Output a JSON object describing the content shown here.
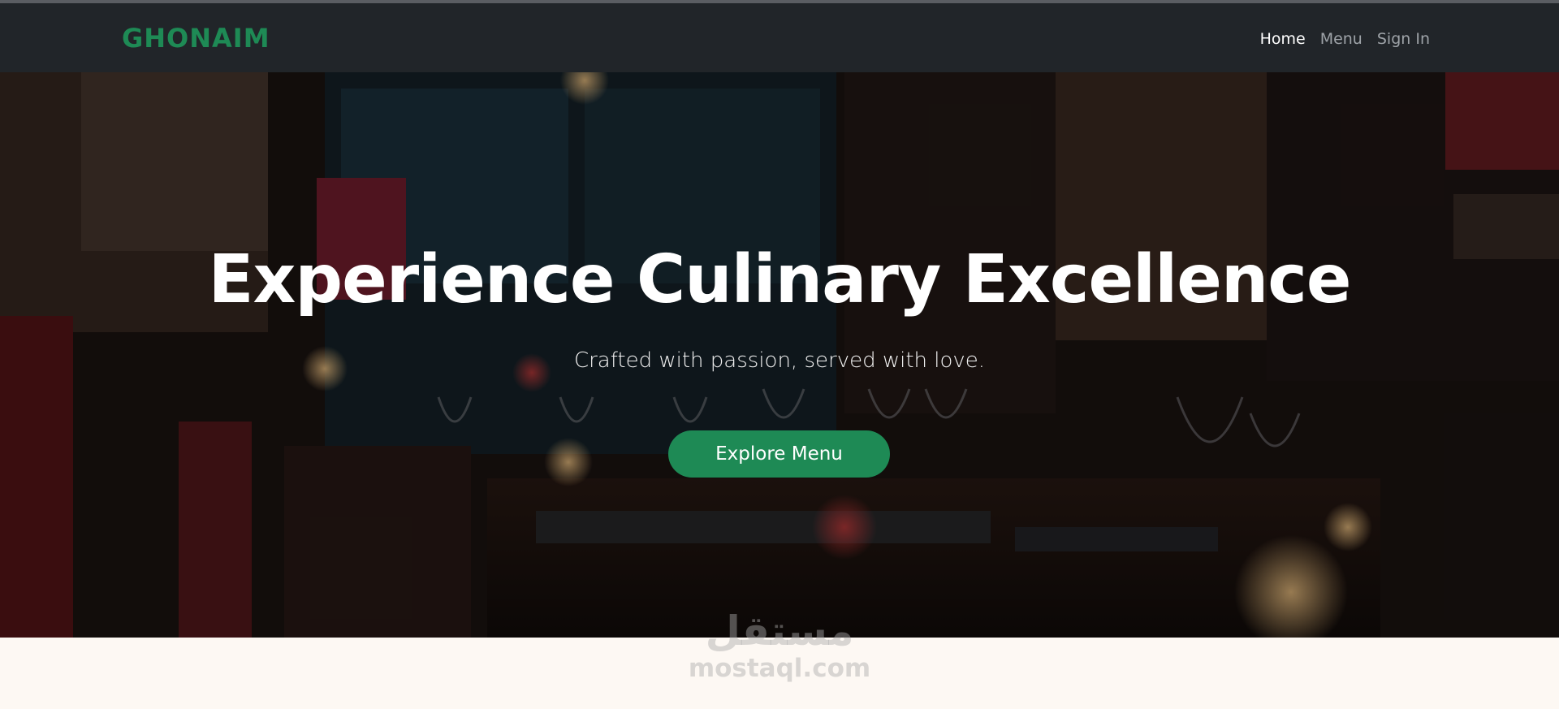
{
  "brand": {
    "name": "GHONAIM",
    "color": "#1e8a55"
  },
  "nav": {
    "items": [
      {
        "label": "Home",
        "active": true
      },
      {
        "label": "Menu",
        "active": false
      },
      {
        "label": "Sign In",
        "active": false
      }
    ]
  },
  "hero": {
    "title": "Experience Culinary Excellence",
    "subtitle": "Crafted with passion, served with love.",
    "cta_label": "Explore Menu",
    "background": "restaurant-interior-photo"
  },
  "watermark": {
    "logo": "مستقل",
    "url": "mostaql.com"
  },
  "colors": {
    "navbar": "#212529",
    "accent": "#1e8a55",
    "page_bg": "#fdf8f3"
  }
}
